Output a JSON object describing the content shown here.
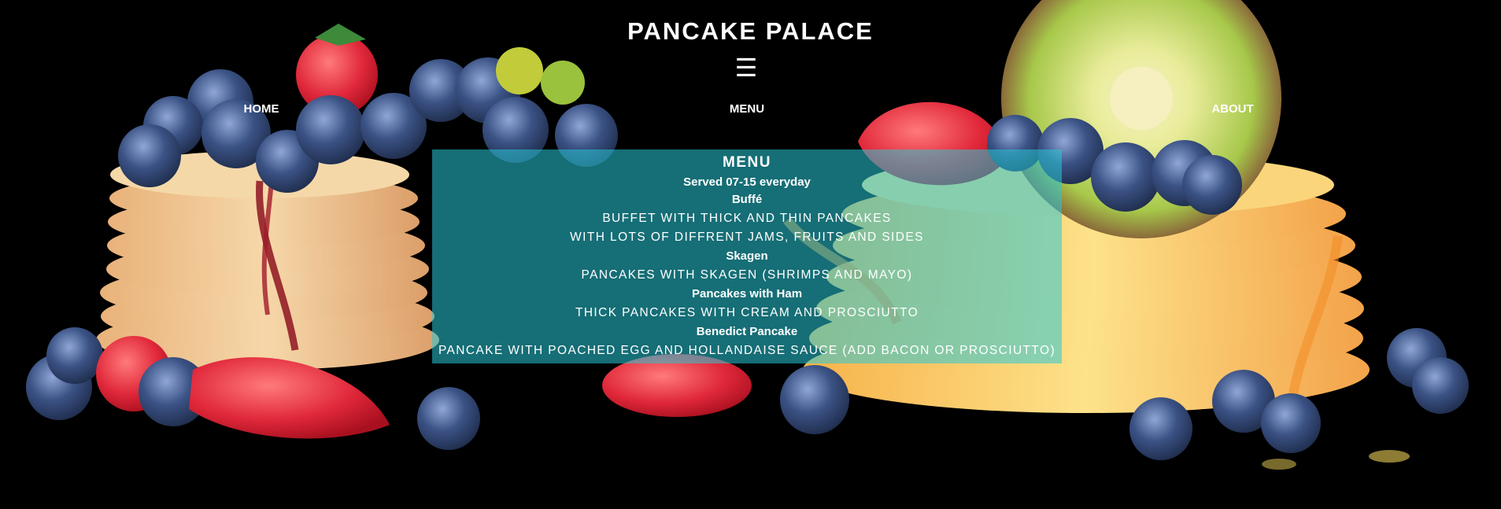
{
  "site": {
    "title": "PANCAKE PALACE",
    "hamburger_glyph": "☰"
  },
  "nav": {
    "items": [
      {
        "label": "HOME"
      },
      {
        "label": "MENU"
      },
      {
        "label": "ABOUT"
      }
    ]
  },
  "menu": {
    "heading": "MENU",
    "hours": "Served 07-15 everyday",
    "items": [
      {
        "name": "Buffé",
        "desc": [
          "Buffet with thick and thin pancakes",
          "with lots of diffrent jams, fruits and sides"
        ]
      },
      {
        "name": "Skagen",
        "desc": [
          "Pancakes with Skagen (shrimps and mayo)"
        ]
      },
      {
        "name": "Pancakes with Ham",
        "desc": [
          "Thick pancakes with cream and prosciutto"
        ]
      },
      {
        "name": "Benedict Pancake",
        "desc": [
          "Pancake with poached egg and hollandaise sauce (add bacon or prosciutto)"
        ]
      }
    ]
  },
  "colors": {
    "background": "#000000",
    "panel": "#28c8d7",
    "text": "#ffffff",
    "strawberry": "#e0283a",
    "blueberry": "#2b3f66",
    "kiwi": "#9bc23c",
    "pancake": "#f2c48a"
  }
}
